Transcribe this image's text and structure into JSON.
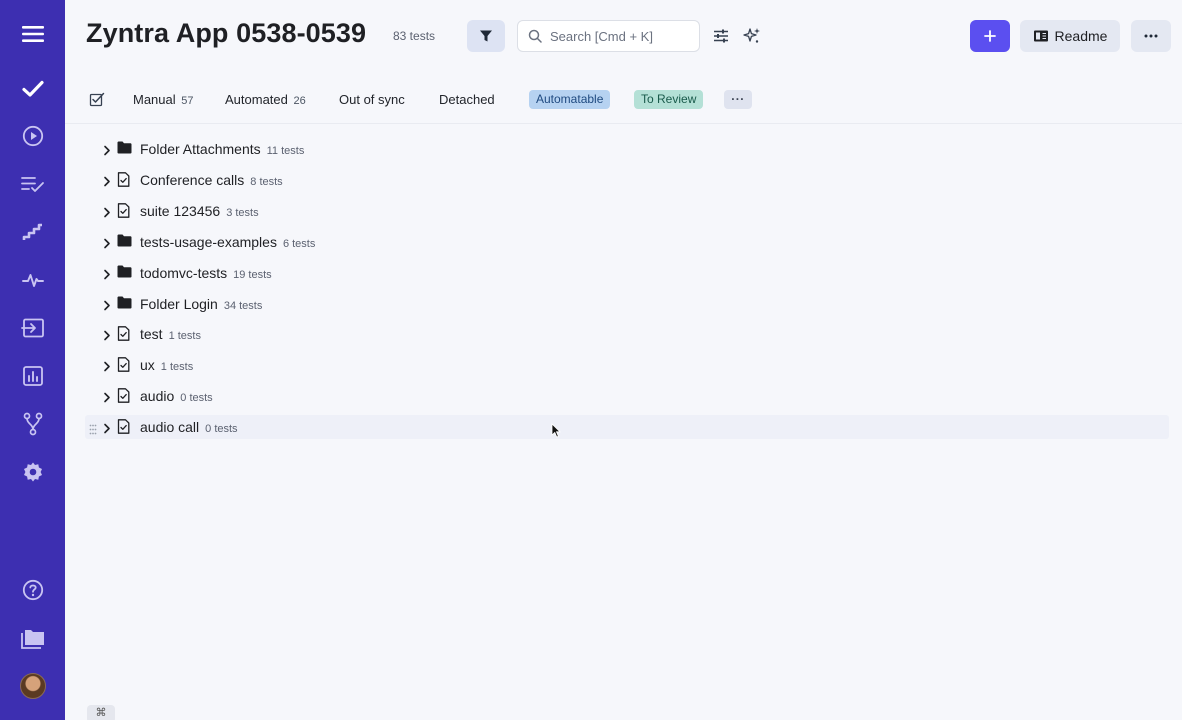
{
  "header": {
    "title": "Zyntra App 0538-0539",
    "count": "83 tests",
    "search_placeholder": "Search [Cmd + K]",
    "readme_label": "Readme"
  },
  "tabs": {
    "manual": {
      "label": "Manual",
      "count": "57"
    },
    "automated": {
      "label": "Automated",
      "count": "26"
    },
    "out_of_sync": "Out of sync",
    "detached": "Detached",
    "automatable": "Automatable",
    "to_review": "To Review",
    "more": "···"
  },
  "tree": [
    {
      "name": "Folder Attachments",
      "count": "11 tests",
      "icon": "folder-icon"
    },
    {
      "name": "Conference calls",
      "count": "8 tests",
      "icon": "suite-file-icon"
    },
    {
      "name": "suite 123456",
      "count": "3 tests",
      "icon": "suite-file-icon"
    },
    {
      "name": "tests-usage-examples",
      "count": "6 tests",
      "icon": "folder-icon"
    },
    {
      "name": "todomvc-tests",
      "count": "19 tests",
      "icon": "folder-icon"
    },
    {
      "name": "Folder Login",
      "count": "34 tests",
      "icon": "folder-icon"
    },
    {
      "name": "test",
      "count": "1 tests",
      "icon": "suite-file-icon"
    },
    {
      "name": "ux",
      "count": "1 tests",
      "icon": "suite-file-icon"
    },
    {
      "name": "audio",
      "count": "0 tests",
      "icon": "suite-file-icon"
    },
    {
      "name": "audio call",
      "count": "0 tests",
      "icon": "suite-file-icon"
    }
  ],
  "shortcut_hint": "⌘",
  "colors": {
    "sidebar": "#3d2fb1",
    "accent": "#5b4ff0",
    "automatable_chip": "#b6d2f1",
    "to_review_chip": "#b4e0d6"
  }
}
